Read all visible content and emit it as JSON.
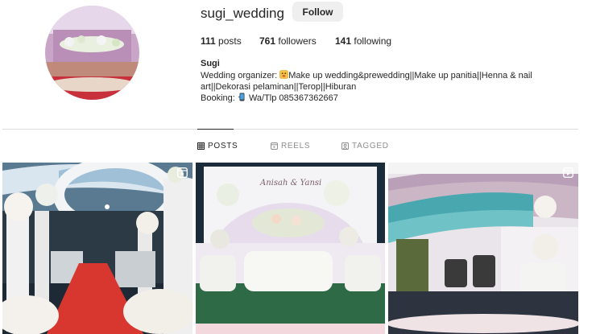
{
  "profile": {
    "username": "sugi_wedding",
    "follow_label": "Follow",
    "stats": {
      "posts_count": "111",
      "posts_label": "posts",
      "followers_count": "761",
      "followers_label": "followers",
      "following_count": "141",
      "following_label": "following"
    },
    "name": "Sugi",
    "bio_line1_a": "Wedding organizer: ",
    "bio_line1_b": "Make up wedding&prewedding||Make up panitia||Henna & nail",
    "bio_line2": "art||Dekorasi pelaminan||Terop||Hiburan",
    "bio_line3_a": "Booking: ",
    "bio_line3_b": "Wa/Tlp 085367362667"
  },
  "tabs": [
    {
      "label": "POSTS",
      "icon": "grid-icon",
      "active": true
    },
    {
      "label": "REELS",
      "icon": "reels-icon",
      "active": false
    },
    {
      "label": "TAGGED",
      "icon": "tagged-icon",
      "active": false
    }
  ],
  "posts": [
    {
      "icon": "reel-badge-icon"
    },
    {
      "caption_script": "Anisah & Yansi"
    },
    {
      "icon": "reel-badge-icon"
    }
  ],
  "colors": {
    "text": "#262626",
    "muted": "#8e8e8e",
    "divider": "#dbdbdb",
    "button_bg": "#efefef"
  }
}
